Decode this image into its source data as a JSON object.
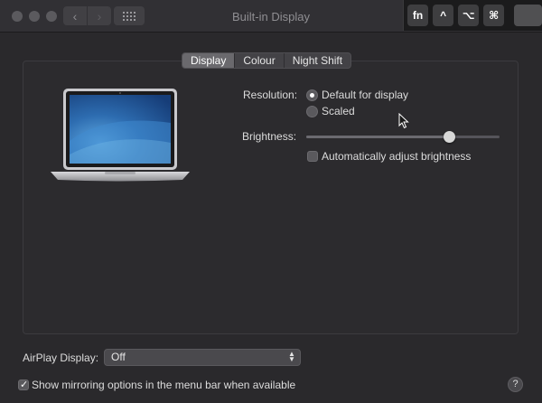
{
  "window": {
    "title": "Built-in Display",
    "back_glyph": "‹",
    "forward_glyph": "›"
  },
  "modifier_keys": [
    "fn",
    "^",
    "⌥",
    "⌘",
    ""
  ],
  "tabs": [
    {
      "label": "Display",
      "active": true
    },
    {
      "label": "Colour",
      "active": false
    },
    {
      "label": "Night Shift",
      "active": false
    }
  ],
  "display": {
    "resolution_label": "Resolution:",
    "resolution_options": [
      {
        "label": "Default for display",
        "selected": true
      },
      {
        "label": "Scaled",
        "selected": false
      }
    ],
    "brightness_label": "Brightness:",
    "brightness_level": 0.74,
    "auto_brightness_label": "Automatically adjust brightness",
    "auto_brightness_checked": false
  },
  "airplay": {
    "label": "AirPlay Display:",
    "selected": "Off"
  },
  "mirroring": {
    "label": "Show mirroring options in the menu bar when available",
    "checked": true
  },
  "help_glyph": "?",
  "colors": {
    "window_bg": "#2a292c",
    "titlebar_bg": "#313034",
    "accent_tab": "#6a696d"
  }
}
